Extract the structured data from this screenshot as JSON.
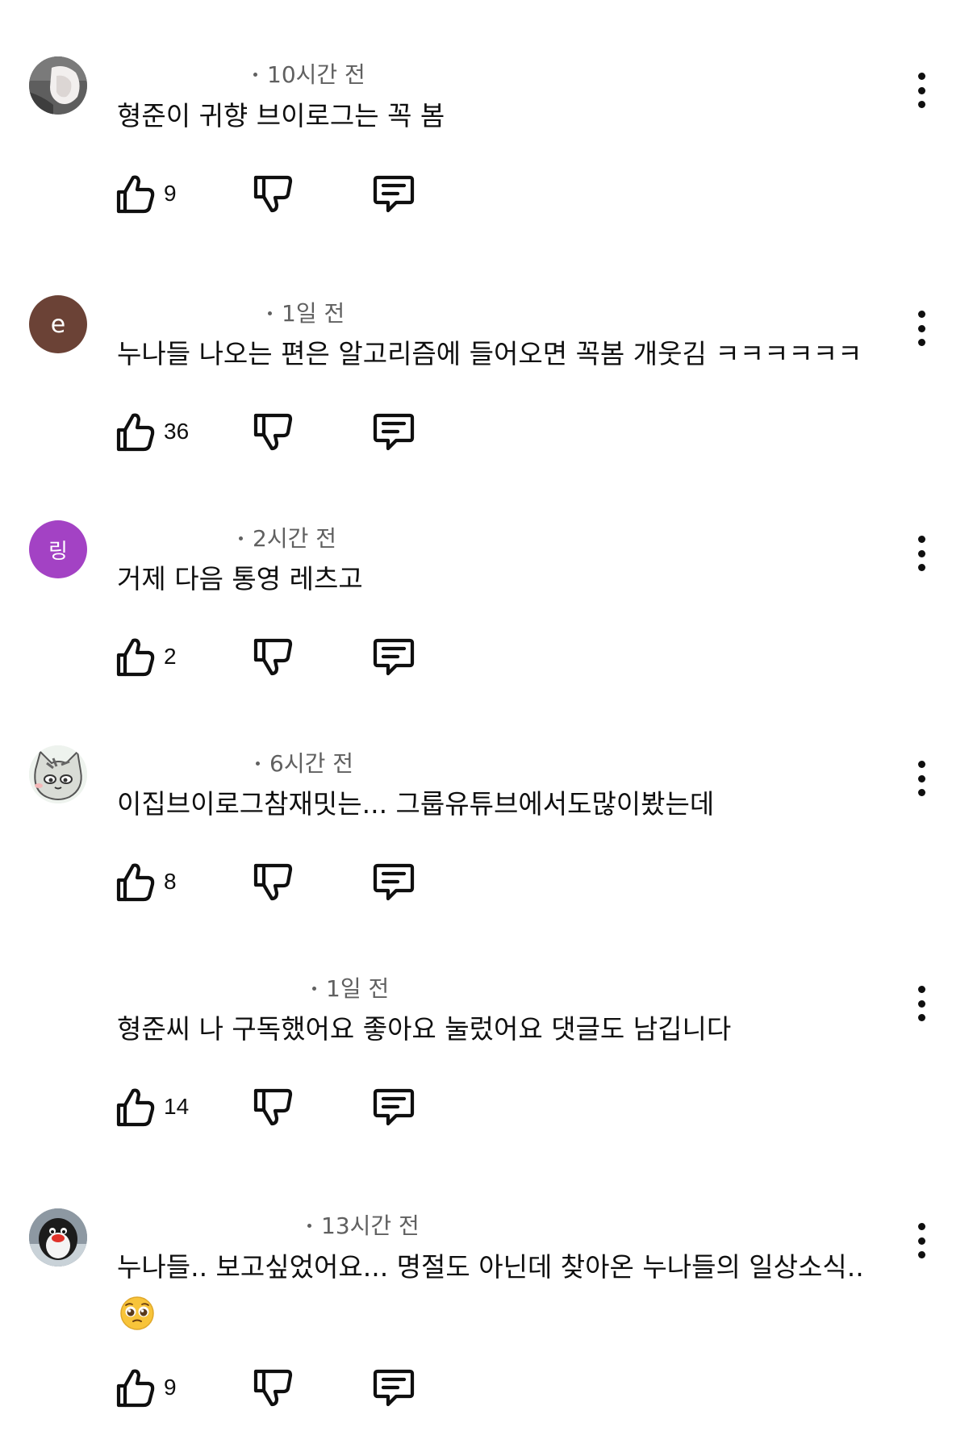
{
  "comments": [
    {
      "time": "10시간 전",
      "text": "형준이 귀향 브이로그는 꼭 봄",
      "likes": "9",
      "avatar": {
        "type": "image",
        "icon": "profile-photo-hand",
        "bg": "#9a9a9a"
      }
    },
    {
      "time": "1일 전",
      "text": "누나들 나오는 편은 알고리즘에 들어오면 꼭봄 개웃김 ㅋㅋㅋㅋㅋㅋ",
      "likes": "36",
      "avatar": {
        "type": "letter",
        "letter": "e",
        "bg": "#6b4236"
      }
    },
    {
      "time": "2시간 전",
      "text": "거제 다음 통영 레츠고",
      "likes": "2",
      "avatar": {
        "type": "letter",
        "letter": "링",
        "bg": "#a342c4"
      }
    },
    {
      "time": "6시간 전",
      "text": "이집브이로그참재밋는... 그룹유튜브에서도많이봤는데",
      "likes": "8",
      "avatar": {
        "type": "image",
        "icon": "cartoon-cat-avatar",
        "bg": "#e8efe8"
      }
    },
    {
      "time": "1일 전",
      "text": "형준씨 나 구독했어요 좋아요 눌렀어요 댓글도 남깁니다",
      "likes": "14",
      "avatar": {
        "type": "none"
      }
    },
    {
      "time": "13시간 전",
      "text": "누나들.. 보고싶었어요... 명절도 아닌데 찾아온 누나들의 일상소식..",
      "likes": "9",
      "extra_emoji": "pleading-face-emoji",
      "avatar": {
        "type": "image",
        "icon": "penguin-avatar",
        "bg": "#7d8a96"
      }
    }
  ],
  "colors": {
    "text": "#0f0f0f",
    "meta": "#606060"
  }
}
